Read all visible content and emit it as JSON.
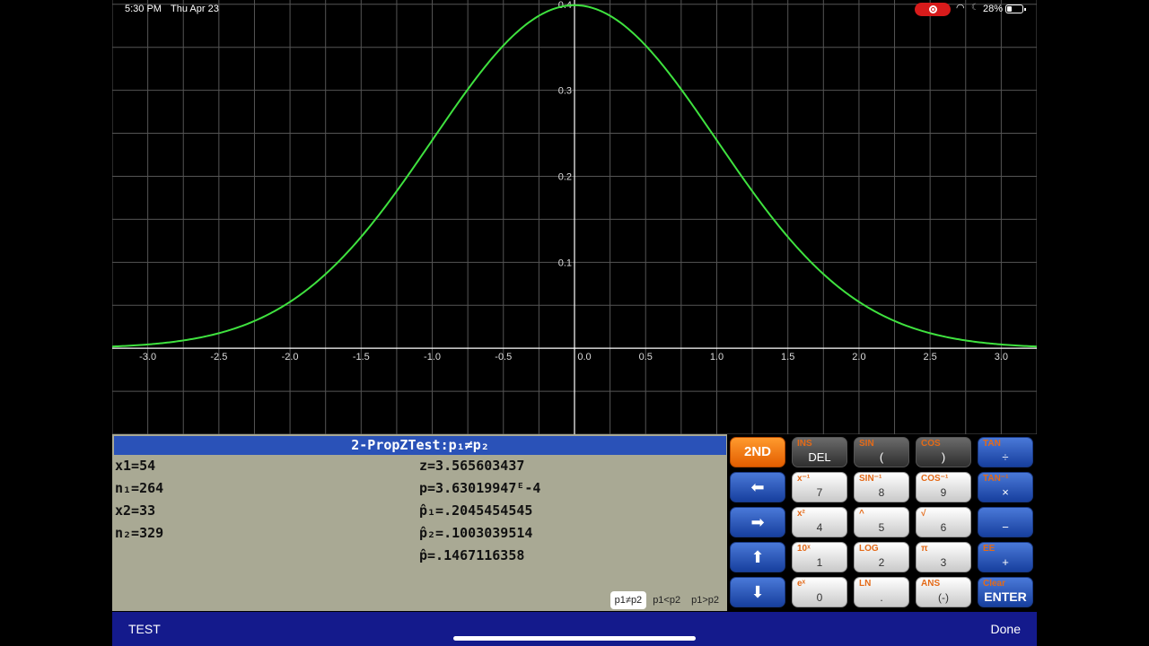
{
  "status_bar": {
    "time": "5:30 PM",
    "date": "Thu Apr 23",
    "battery": "28%"
  },
  "graph": {
    "x_ticks": [
      "-3.0",
      "-2.5",
      "-2.0",
      "-1.5",
      "-1.0",
      "-0.5",
      "0.0",
      "0.5",
      "1.0",
      "1.5",
      "2.0",
      "2.5",
      "3.0"
    ],
    "y_ticks": [
      "0.1",
      "0.2",
      "0.3",
      "0.4"
    ],
    "curve_color": "#3fe23f",
    "grid_color": "#555555"
  },
  "chart_data": {
    "type": "line",
    "title": "",
    "xlabel": "",
    "ylabel": "",
    "xlim": [
      -3.25,
      3.25
    ],
    "ylim": [
      -0.1,
      0.405
    ],
    "grid": true,
    "series": [
      {
        "function": "standard normal pdf",
        "x": [
          -3.0,
          -2.5,
          -2.0,
          -1.5,
          -1.0,
          -0.5,
          0.0,
          0.5,
          1.0,
          1.5,
          2.0,
          2.5,
          3.0
        ],
        "y": [
          0.0044,
          0.0175,
          0.054,
          0.1295,
          0.242,
          0.3521,
          0.3989,
          0.3521,
          0.242,
          0.1295,
          0.054,
          0.0175,
          0.0044
        ]
      }
    ]
  },
  "results": {
    "title": "2-PropZTest:p₁≠p₂",
    "left": [
      "x1=54",
      "n₁=264",
      "x2=33",
      "n₂=329"
    ],
    "right": [
      "z=3.565603437",
      "p=3.63019947ᴱ-4",
      "p̂₁=.2045454545",
      "p̂₂=.1003039514",
      "p̂=.1467116358"
    ],
    "alternatives": [
      "p1≠p2",
      "p1<p2",
      "p1>p2"
    ]
  },
  "keypad": {
    "second": "2ND",
    "del": {
      "sec": "INS",
      "prim": "DEL"
    },
    "sin": {
      "sec": "SIN",
      "prim": "("
    },
    "cos": {
      "sec": "COS",
      "prim": ")"
    },
    "tan": {
      "sec": "TAN",
      "prim": "÷"
    },
    "k7": {
      "sec": "x⁻¹",
      "prim": "7"
    },
    "k8": {
      "sec": "SIN⁻¹",
      "prim": "8"
    },
    "k9": {
      "sec": "COS⁻¹",
      "prim": "9"
    },
    "mul": {
      "sec": "TAN⁻¹",
      "prim": "×"
    },
    "k4": {
      "sec": "x²",
      "prim": "4"
    },
    "k5": {
      "sec": "^",
      "prim": "5"
    },
    "k6": {
      "sec": "√",
      "prim": "6"
    },
    "minus": {
      "sec": "",
      "prim": "−"
    },
    "k1": {
      "sec": "10ˣ",
      "prim": "1"
    },
    "k2": {
      "sec": "LOG",
      "prim": "2"
    },
    "k3": {
      "sec": "π",
      "prim": "3"
    },
    "plus": {
      "sec": "EE",
      "prim": "+"
    },
    "k0": {
      "sec": "eˣ",
      "prim": "0"
    },
    "dot": {
      "sec": "LN",
      "prim": "."
    },
    "neg": {
      "sec": "ANS",
      "prim": "(-)"
    },
    "enter": {
      "sec": "Clear",
      "prim": "ENTER"
    }
  },
  "bottom_bar": {
    "left": "TEST",
    "right": "Done"
  }
}
